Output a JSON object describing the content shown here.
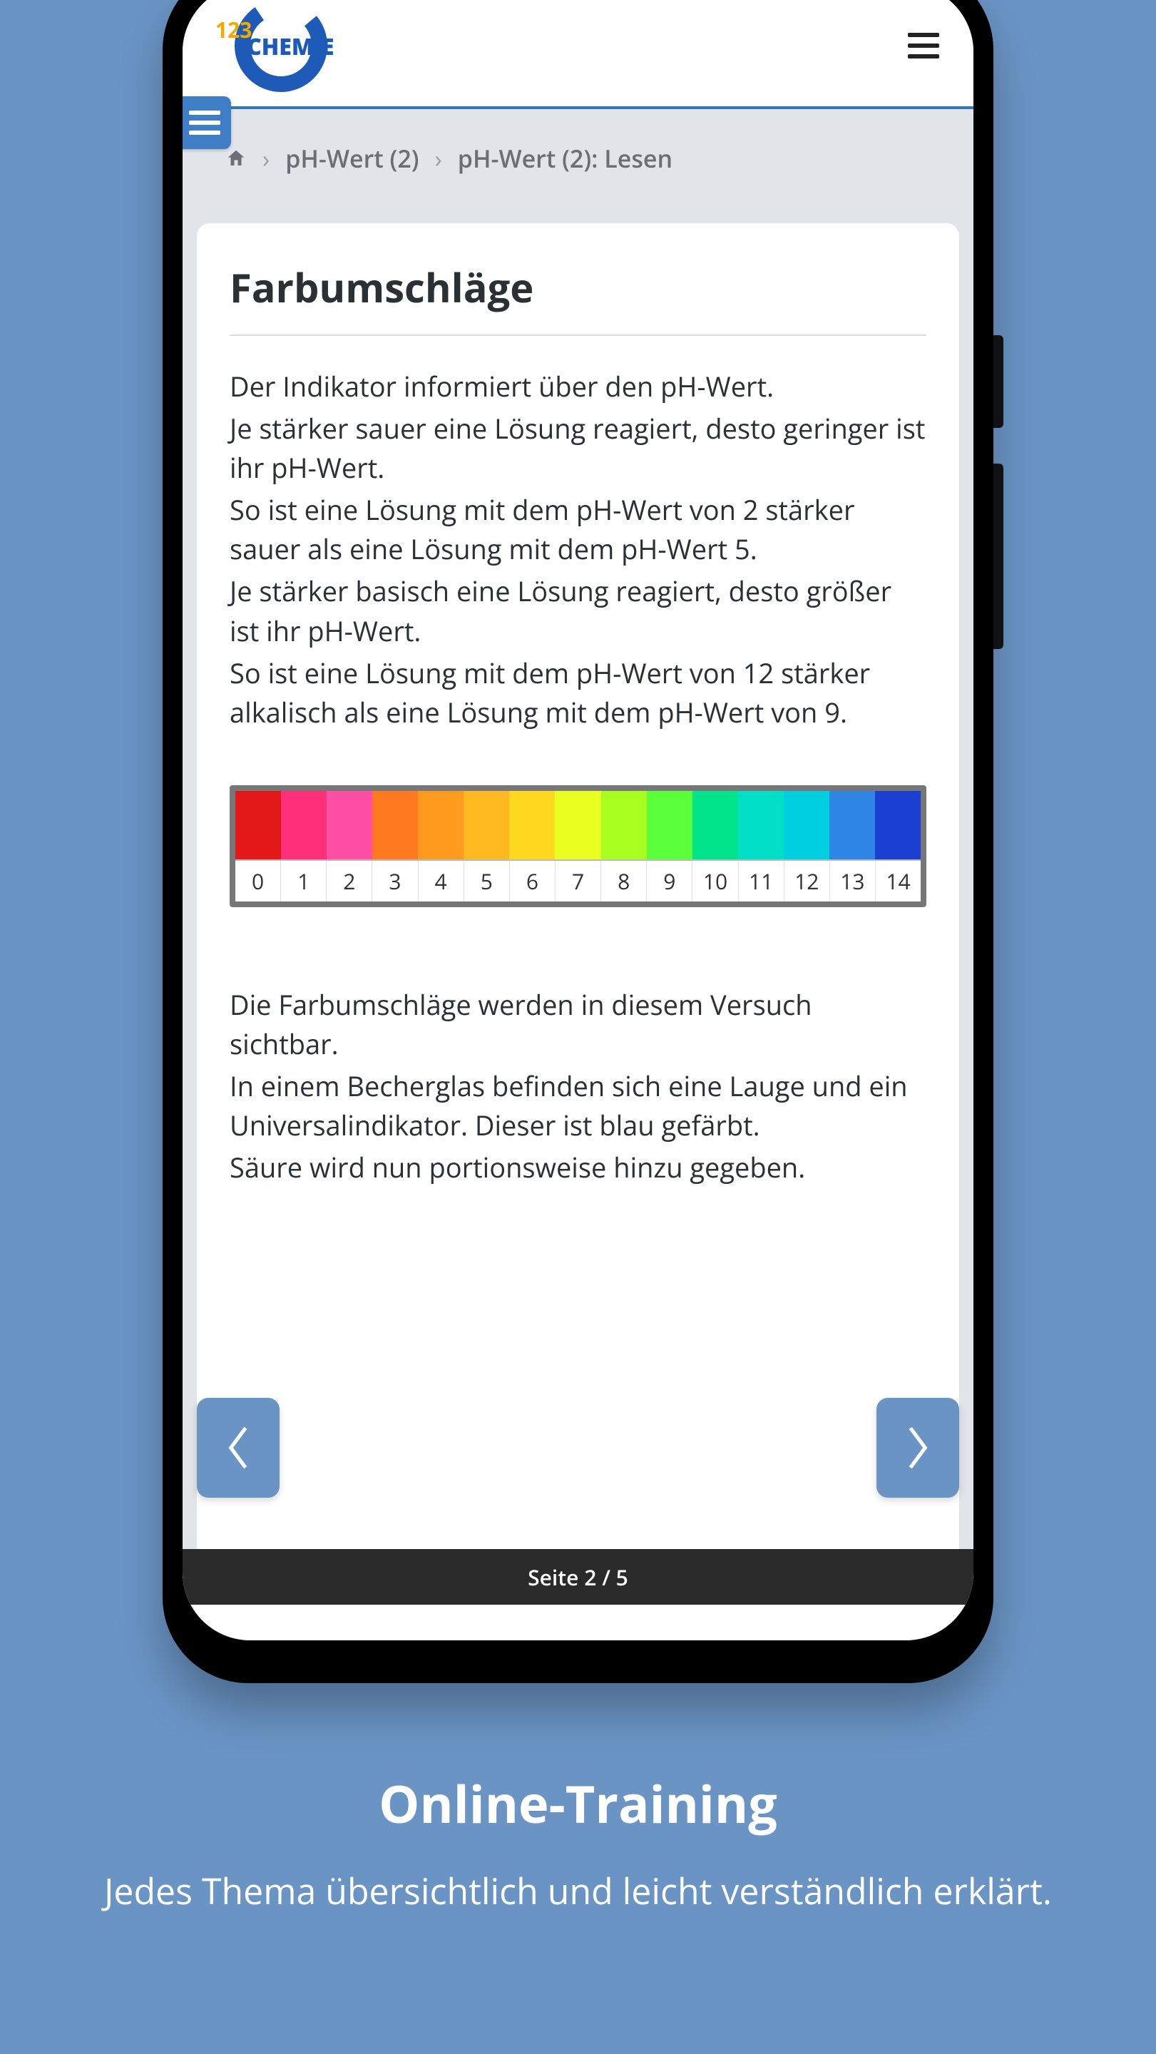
{
  "logo": {
    "prefix": "123",
    "word": "CHEMIE"
  },
  "breadcrumb": {
    "item1": "pH-Wert (2)",
    "item2": "pH-Wert (2): Lesen"
  },
  "article": {
    "title": "Farbumschläge",
    "p1": "Der Indikator informiert über den pH-Wert.",
    "p2": "Je stärker sauer eine Lösung reagiert, desto geringer ist ihr pH-Wert.",
    "p3": "So ist eine Lösung mit dem pH-Wert von 2 stärker sauer als eine Lösung mit dem pH-Wert 5.",
    "p4": "Je stärker basisch eine Lösung reagiert, desto größer ist ihr pH-Wert.",
    "p5": "So ist eine Lösung mit dem pH-Wert von 12 stärker alkalisch als eine Lösung mit dem pH-Wert von 9.",
    "p6": "Die Farbumschläge werden in diesem Versuch sichtbar.",
    "p7": "In einem Becherglas befinden sich eine Lauge und ein Universalindikator. Dieser ist blau gefärbt.",
    "p8": "Säure wird nun portionsweise hinzu gegeben."
  },
  "ph_scale": {
    "labels": [
      "0",
      "1",
      "2",
      "3",
      "4",
      "5",
      "6",
      "7",
      "8",
      "9",
      "10",
      "11",
      "12",
      "13",
      "14"
    ],
    "colors": [
      "#e31919",
      "#ff2f7a",
      "#ff4fa4",
      "#ff7a1f",
      "#ff9a1f",
      "#ffb81f",
      "#ffd91f",
      "#e8ff1f",
      "#a6ff1f",
      "#5bff3a",
      "#00e58c",
      "#00e0c7",
      "#00cfe0",
      "#2f86e6",
      "#1b3fd1"
    ]
  },
  "pager": {
    "label": "Seite 2 / 5"
  },
  "promo": {
    "heading": "Online-Training",
    "sub": "Jedes Thema übersichtlich und leicht verständlich erklärt."
  }
}
